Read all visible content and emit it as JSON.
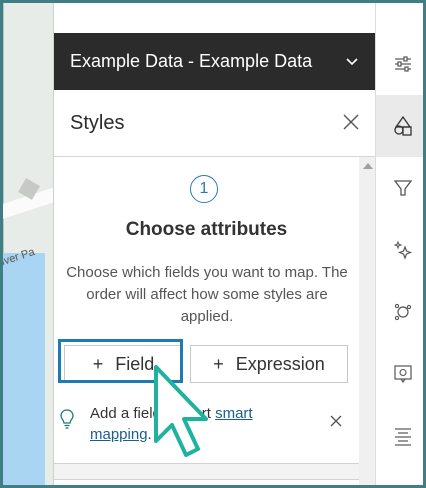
{
  "map": {
    "road_label": "iver Pa"
  },
  "layer_selector": {
    "title": "Example Data - Example Data",
    "icon": "chevron-down-icon"
  },
  "styles_panel": {
    "title": "Styles",
    "close_icon": "close-icon"
  },
  "step": {
    "number": "1",
    "heading": "Choose attributes",
    "description": "Choose which fields you want to map. The order will affect how some styles are applied."
  },
  "buttons": {
    "field": {
      "icon": "+",
      "label": "Field"
    },
    "expression": {
      "icon": "+",
      "label": "Expression"
    }
  },
  "notice": {
    "text_prefix": "Add a field to start ",
    "link_text": "smart mapping",
    "text_suffix": ".",
    "icon": "lightbulb-icon",
    "close_icon": "close-icon"
  },
  "rail": {
    "items": [
      {
        "name": "properties-icon"
      },
      {
        "name": "styles-icon",
        "active": true
      },
      {
        "name": "filter-icon"
      },
      {
        "name": "effects-icon"
      },
      {
        "name": "clustering-icon"
      },
      {
        "name": "popups-icon"
      },
      {
        "name": "fields-icon"
      }
    ]
  },
  "colors": {
    "accent": "#1d7ab3",
    "dark_bar": "#2b2b2b",
    "cursor": "#20b2a0"
  }
}
